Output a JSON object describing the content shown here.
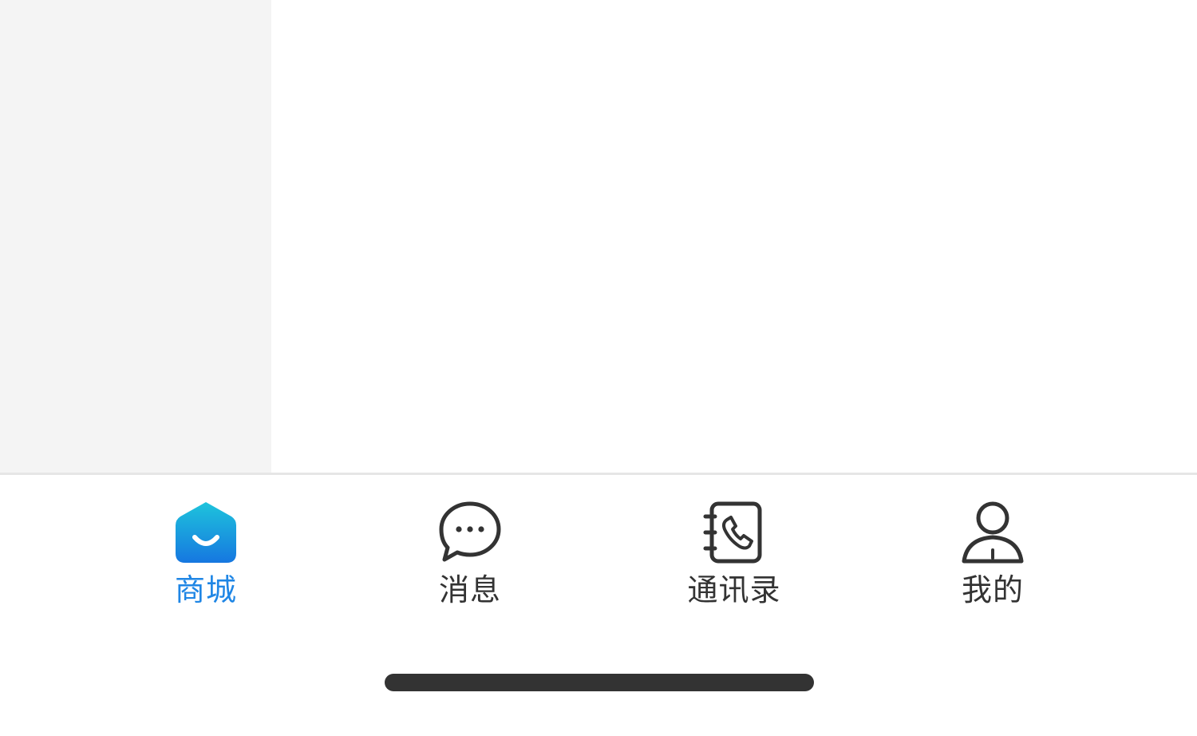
{
  "tabbar": {
    "tabs": [
      {
        "label": "商城",
        "icon": "shop-home-icon",
        "active": true
      },
      {
        "label": "消息",
        "icon": "chat-bubble-icon",
        "active": false
      },
      {
        "label": "通讯录",
        "icon": "contacts-book-icon",
        "active": false
      },
      {
        "label": "我的",
        "icon": "user-profile-icon",
        "active": false
      }
    ],
    "active_color": "#1f86e5",
    "inactive_color": "#333333"
  },
  "colors": {
    "sidebar_bg": "#f4f4f4",
    "content_bg": "#ffffff",
    "home_indicator": "#333333"
  }
}
